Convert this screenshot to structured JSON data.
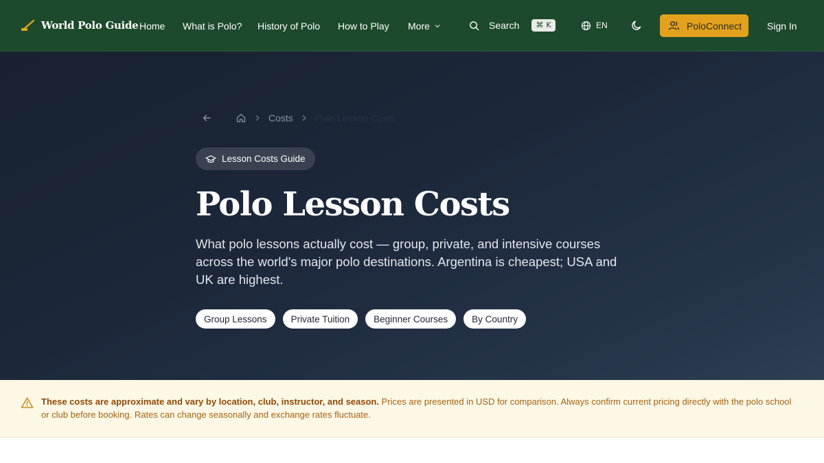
{
  "header": {
    "brand": "World Polo Guide",
    "nav": [
      "Home",
      "What is Polo?",
      "History of Polo",
      "How to Play"
    ],
    "more_label": "More",
    "search_label": "Search",
    "search_shortcut": "K",
    "language": "EN",
    "poloconnect_label": "PoloConnect",
    "signin_label": "Sign In"
  },
  "breadcrumb": {
    "items": [
      "Costs",
      "Polo Lesson Costs"
    ]
  },
  "hero": {
    "badge": "Lesson Costs Guide",
    "title": "Polo Lesson Costs",
    "subtitle": "What polo lessons actually cost — group, private, and intensive courses across the world's major polo destinations. Argentina is cheapest; USA and UK are highest.",
    "chips": [
      "Group Lessons",
      "Private Tuition",
      "Beginner Courses",
      "By Country"
    ]
  },
  "notice": {
    "strong": "These costs are approximate and vary by location, club, instructor, and season.",
    "text": " Prices are presented in USD for comparison. Always confirm current pricing directly with the polo school or club before booking. Rates can change seasonally and exchange rates fluctuate."
  },
  "colors": {
    "nav_bg": "#1d4a2c",
    "accent": "#e2a21e",
    "hero_bg": "#1c283a",
    "notice_bg": "#fdf7e5",
    "notice_text": "#a36415"
  },
  "icons": [
    "mallet-icon",
    "chevron-down-icon",
    "search-icon",
    "command-icon",
    "globe-icon",
    "moon-icon",
    "users-icon",
    "arrow-left-icon",
    "home-icon",
    "chevron-right-icon",
    "graduation-cap-icon",
    "warning-icon"
  ]
}
